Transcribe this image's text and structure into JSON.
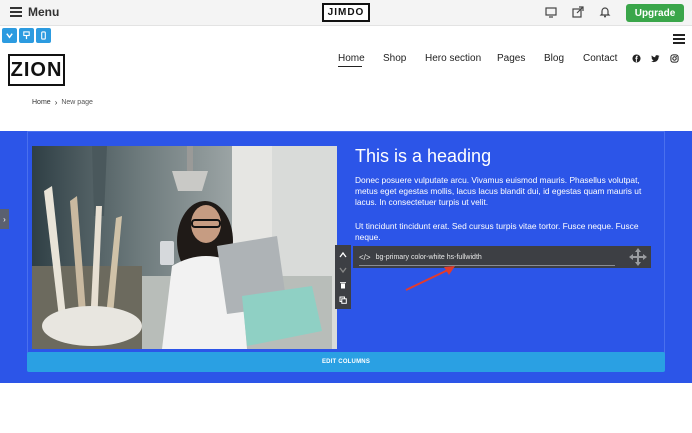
{
  "editor": {
    "menu_label": "Menu",
    "brand": "JIMDO",
    "upgrade_label": "Upgrade"
  },
  "site": {
    "logo": "ZION",
    "nav": [
      "Home",
      "Shop",
      "Hero section",
      "Pages",
      "Blog",
      "Contact"
    ],
    "active_nav": "Home",
    "breadcrumb": {
      "home": "Home",
      "current": "New page"
    }
  },
  "section": {
    "heading": "This is a heading",
    "paragraph1": "Donec posuere vulputate arcu. Vivamus euismod mauris. Phasellus volutpat, metus eget egestas mollis, lacus lacus blandit dui, id egestas quam mauris ut lacus. In consectetuer turpis ut velit.",
    "paragraph2": "Ut tincidunt tincidunt erat. Sed cursus turpis vitae tortor. Fusce neque. Fusce neque.",
    "class_input_value": "bg-primary color-white hs-fullwidth",
    "edit_columns_label": "EDIT COLUMNS",
    "background_color": "#2c55e8"
  },
  "icons": {
    "top": [
      "desktop-icon",
      "share-icon",
      "bell-icon"
    ],
    "social": [
      "facebook-icon",
      "twitter-icon",
      "instagram-icon"
    ]
  }
}
